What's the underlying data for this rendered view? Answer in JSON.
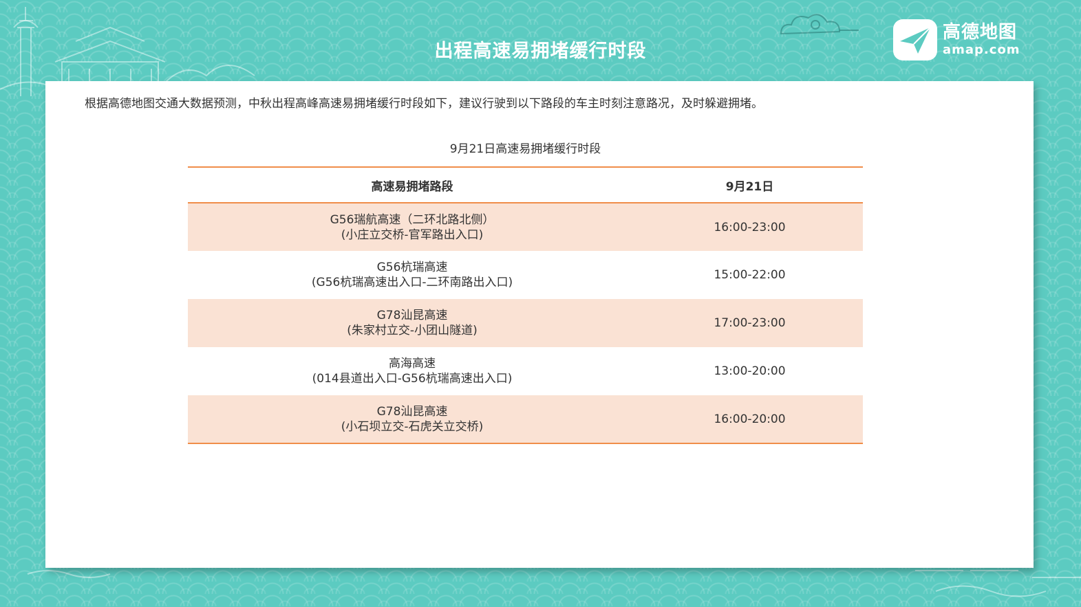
{
  "header": {
    "title": "出程高速易拥堵缓行时段",
    "logo_cn": "高德地图",
    "logo_en": "amap.com"
  },
  "intro": "根据高德地图交通大数据预测，中秋出程高峰高速易拥堵缓行时段如下，建议行驶到以下路段的车主时刻注意路况，及时躲避拥堵。",
  "table": {
    "caption": "9月21日高速易拥堵缓行时段",
    "columns": [
      "高速易拥堵路段",
      "9月21日"
    ],
    "rows": [
      {
        "road": "G56瑞航高速（二环北路北侧）",
        "range": "(小庄立交桥-官军路出入口)",
        "time": "16:00-23:00"
      },
      {
        "road": "G56杭瑞高速",
        "range": "(G56杭瑞高速出入口-二环南路出入口)",
        "time": "15:00-22:00"
      },
      {
        "road": "G78汕昆高速",
        "range": "(朱家村立交-小团山隧道)",
        "time": "17:00-23:00"
      },
      {
        "road": "高海高速",
        "range": "(014县道出入口-G56杭瑞高速出入口)",
        "time": "13:00-20:00"
      },
      {
        "road": "G78汕昆高速",
        "range": "(小石坝立交-石虎关立交桥)",
        "time": "16:00-20:00"
      }
    ]
  },
  "colors": {
    "background": "#5ccbc1",
    "accent_line": "#f08d49",
    "row_highlight": "#fae2d4"
  }
}
